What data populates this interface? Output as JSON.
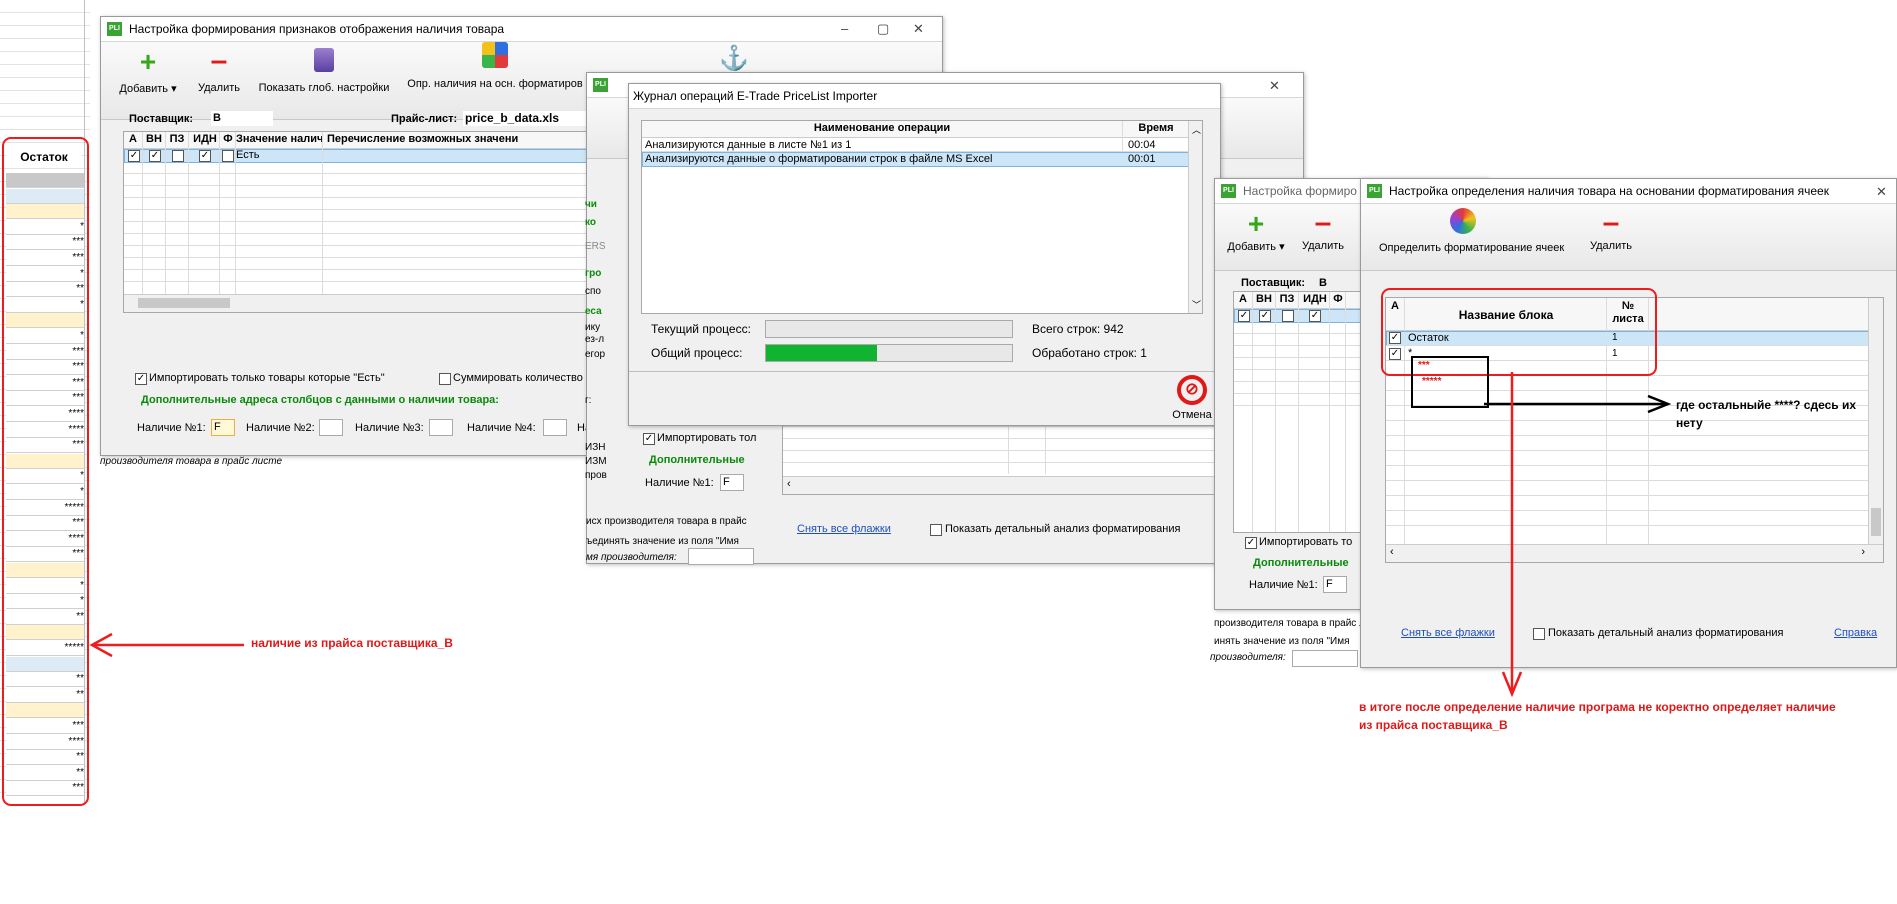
{
  "sheet": {
    "header": "Остаток",
    "cells": [
      "",
      "",
      "",
      "*",
      "***",
      "***",
      "*",
      "**",
      "*",
      "",
      "*",
      "***",
      "***",
      "***",
      "***",
      "****",
      "****",
      "***",
      "",
      "*",
      "*",
      "*****",
      "***",
      "****",
      "***",
      "",
      "*",
      "*",
      "**",
      "",
      "*****",
      "",
      "**",
      "**",
      "",
      "***",
      "****",
      "**",
      "**",
      "***"
    ],
    "row_fills": [
      "#c8c8c8",
      "#ddebf7",
      "#fff2cc",
      "#fff",
      "#fff",
      "#fff",
      "#fff",
      "#fff",
      "#fff",
      "#fff2cc",
      "#fff",
      "#fff",
      "#fff",
      "#fff",
      "#fff",
      "#fff",
      "#fff",
      "#fff",
      "#fff2cc",
      "#fff",
      "#fff",
      "#fff",
      "#fff",
      "#fff",
      "#fff",
      "#fff2cc",
      "#fff",
      "#fff",
      "#fff",
      "#fff2cc",
      "#fff",
      "#ddebf7",
      "#fff",
      "#fff",
      "#fff2cc",
      "#fff",
      "#fff",
      "#fff",
      "#fff",
      "#fff"
    ]
  },
  "annotations": {
    "left_note": "наличие из прайса поставщика_B",
    "right_note": "где остальныйе ****? сдесь их нету",
    "bottom_note_line1": "в итоге после определение наличие програма не коректно определяет наличие",
    "bottom_note_line2": "из прайса поставщика_B"
  },
  "win1": {
    "title": "Настройка формирования признаков отображения наличия товара",
    "toolbar": {
      "add": "Добавить",
      "delete": "Удалить",
      "show_global": "Показать глоб. настройки",
      "detect": "Опр. наличия на осн. форматиров"
    },
    "supplier_label": "Поставщик:",
    "supplier_value": "B",
    "pricelist_label": "Прайс-лист:",
    "pricelist_value": "price_b_data.xls",
    "columns": [
      "А",
      "ВН",
      "ПЗ",
      "ИДН",
      "Ф",
      "Значение налич",
      "Перечисление возможных значени"
    ],
    "row_value": "Есть",
    "import_only": "Импортировать только товары которые \"Есть\"",
    "sum_qty": "Суммировать количество",
    "extra_addresses": "Дополнительные адреса столбцов с данными о наличии товара:",
    "avail1_label": "Наличие №1:",
    "avail1_value": "F",
    "avail2_label": "Наличие №2:",
    "avail3_label": "Наличие №3:",
    "avail4_label": "Наличие №4:",
    "avail5_label": "Налич",
    "below_text": "производителя товара в прайс листе"
  },
  "win2": {
    "title": "Журнал операций E-Trade PriceList Importer",
    "col_operation": "Наименование операции",
    "col_time": "Время",
    "rows": [
      {
        "op": "Анализируются данные в листе №1 из 1",
        "time": "00:04"
      },
      {
        "op": "Анализируются данные о форматировании строк в файле MS Excel",
        "time": "00:01"
      }
    ],
    "current_process": "Текущий процесс:",
    "total_process": "Общий процесс:",
    "total_rows": "Всего строк: 942",
    "processed_rows": "Обработано строк: 1",
    "progress_fraction": 0.45,
    "cancel": "Отмена"
  },
  "win_mid": {
    "import_only": "Импортировать тол",
    "extra": "Дополнительные",
    "avail1_label": "Наличие №1:",
    "avail1_value": "F",
    "clear_flags": "Снять все флажки",
    "show_detail": "Показать детальный анализ форматирования",
    "side_texts": [
      "чи",
      "ко",
      "ERS",
      "гро",
      "спо",
      "еса",
      "ику",
      "ез-л",
      "егор",
      "г:",
      "ИЗН",
      "ИЗМ",
      "пров"
    ],
    "bottom_texts": [
      "исх производителя товара в прайс",
      "ъединять значение из поля \"Имя",
      "мя производителя:"
    ]
  },
  "win3": {
    "title": "Настройка формиро",
    "add": "Добавить",
    "delete": "Удалить",
    "supplier_label": "Поставщик:",
    "supplier_value": "B",
    "columns": [
      "А",
      "ВН",
      "ПЗ",
      "ИДН",
      "Ф"
    ],
    "import_only": "Импортировать то",
    "extra": "Дополнительные",
    "avail1_label": "Наличие №1:",
    "avail1_value": "F",
    "bottom_texts": [
      "производителя товара в прайс ли",
      "инять значение из поля \"Имя",
      "производителя:"
    ]
  },
  "win4": {
    "title": "Настройка определения наличия товара на основании форматирования ячеек",
    "detect": "Определить форматирование ячеек",
    "delete": "Удалить",
    "col_a": "А",
    "col_name": "Название блока",
    "col_sheet": "№ листа",
    "rows": [
      {
        "name": "Остаток",
        "sheet": "1"
      },
      {
        "name": "*",
        "sheet": "1"
      }
    ],
    "red_rows": [
      "***",
      "*****"
    ],
    "clear_flags": "Снять все флажки",
    "show_detail": "Показать детальный анализ форматирования",
    "help": "Справка"
  }
}
